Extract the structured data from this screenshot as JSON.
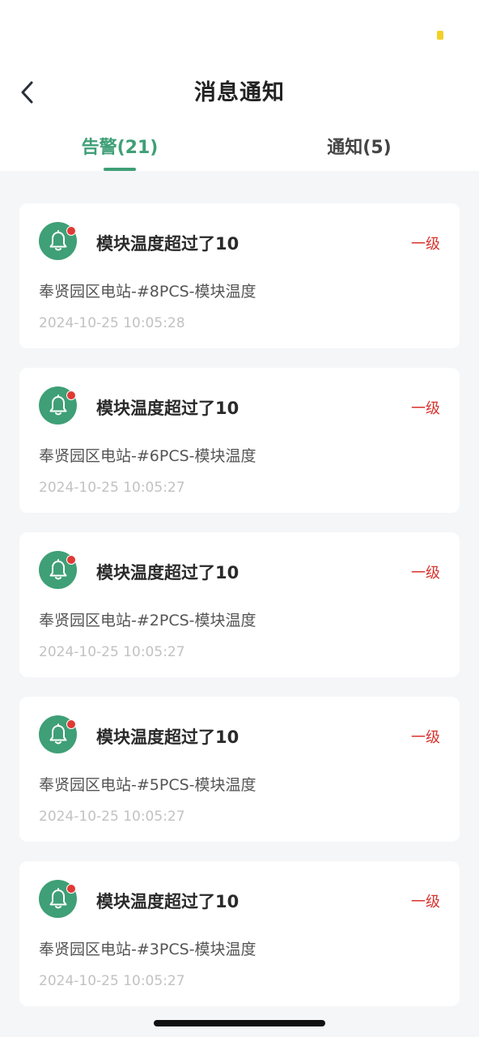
{
  "header": {
    "title": "消息通知",
    "back_icon": "chevron-left-icon"
  },
  "tabs": [
    {
      "label": "告警(21)",
      "active": true
    },
    {
      "label": "通知(5)",
      "active": false
    }
  ],
  "colors": {
    "accent": "#3f9f76",
    "level_red": "#d8332e",
    "battery": "#f2d027"
  },
  "alerts": [
    {
      "icon": "bell-icon",
      "title": "模块温度超过了10",
      "level": "一级",
      "source": "奉贤园区电站-#8PCS-模块温度",
      "time": "2024-10-25 10:05:28"
    },
    {
      "icon": "bell-icon",
      "title": "模块温度超过了10",
      "level": "一级",
      "source": "奉贤园区电站-#6PCS-模块温度",
      "time": "2024-10-25 10:05:27"
    },
    {
      "icon": "bell-icon",
      "title": "模块温度超过了10",
      "level": "一级",
      "source": "奉贤园区电站-#2PCS-模块温度",
      "time": "2024-10-25 10:05:27"
    },
    {
      "icon": "bell-icon",
      "title": "模块温度超过了10",
      "level": "一级",
      "source": "奉贤园区电站-#5PCS-模块温度",
      "time": "2024-10-25 10:05:27"
    },
    {
      "icon": "bell-icon",
      "title": "模块温度超过了10",
      "level": "一级",
      "source": "奉贤园区电站-#3PCS-模块温度",
      "time": "2024-10-25 10:05:27"
    }
  ]
}
